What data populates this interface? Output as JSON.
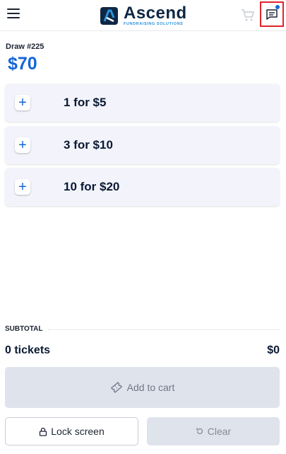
{
  "header": {
    "logo_title": "Ascend",
    "logo_subtitle": "FUNDRAISING SOLUTIONS",
    "icons": [
      "menu-icon",
      "cart-icon",
      "chat-icon"
    ],
    "chat_has_notification": true
  },
  "draw": {
    "label": "Draw #225",
    "amount": "$70"
  },
  "options": [
    {
      "label": "1 for $5"
    },
    {
      "label": "3 for $10"
    },
    {
      "label": "10 for $20"
    }
  ],
  "summary": {
    "subtotal_label": "SUBTOTAL",
    "tickets": "0 tickets",
    "total": "$0"
  },
  "actions": {
    "add_to_cart": "Add to cart",
    "lock_screen": "Lock screen",
    "clear": "Clear"
  },
  "colors": {
    "accent": "#1466d6",
    "navy": "#0f2743",
    "logo_subtitle": "#2a93e0",
    "highlight_border": "#e0242a",
    "option_bg": "#f3f4fb",
    "disabled_bg": "#dfe3ec"
  }
}
